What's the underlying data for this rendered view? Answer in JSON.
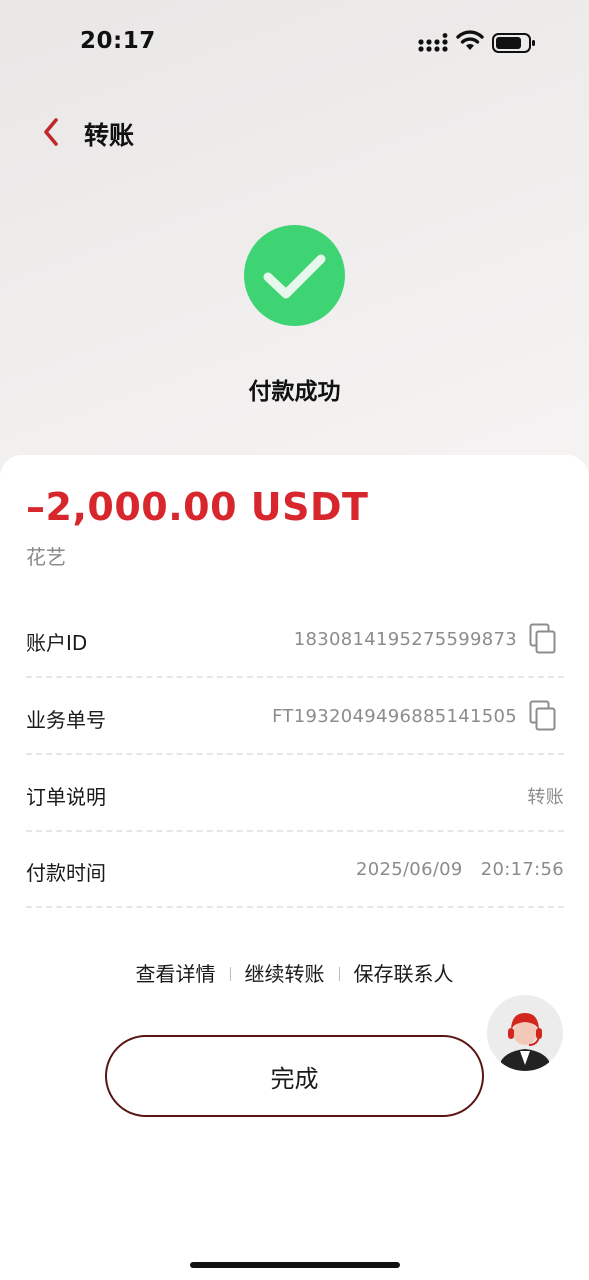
{
  "status_bar": {
    "time": "20:17",
    "icons": [
      "signal-icon",
      "wifi-icon",
      "battery-icon"
    ]
  },
  "nav": {
    "back_icon": "chevron-left-icon",
    "title": "转账"
  },
  "result": {
    "icon": "check-circle-icon",
    "status_text": "付款成功"
  },
  "transaction": {
    "amount": "–2,000.00 USDT",
    "payee": "花艺",
    "rows": [
      {
        "label": "账户ID",
        "value": "1830814195275599873",
        "copy": true
      },
      {
        "label": "业务单号",
        "value": "FT1932049496885141505",
        "copy": true
      },
      {
        "label": "订单说明",
        "value": "转账",
        "copy": false
      },
      {
        "label": "付款时间",
        "value": "2025/06/09   20:17:56",
        "copy": false
      }
    ]
  },
  "actions": {
    "view_details": "查看详情",
    "continue_transfer": "继续转账",
    "save_contact": "保存联系人",
    "done": "完成"
  },
  "colors": {
    "amount": "#d7262c",
    "success": "#3ed474",
    "accent": "#c0282d",
    "button_border": "#5a1515"
  },
  "customer_service": {
    "icon": "customer-service-avatar-icon"
  }
}
